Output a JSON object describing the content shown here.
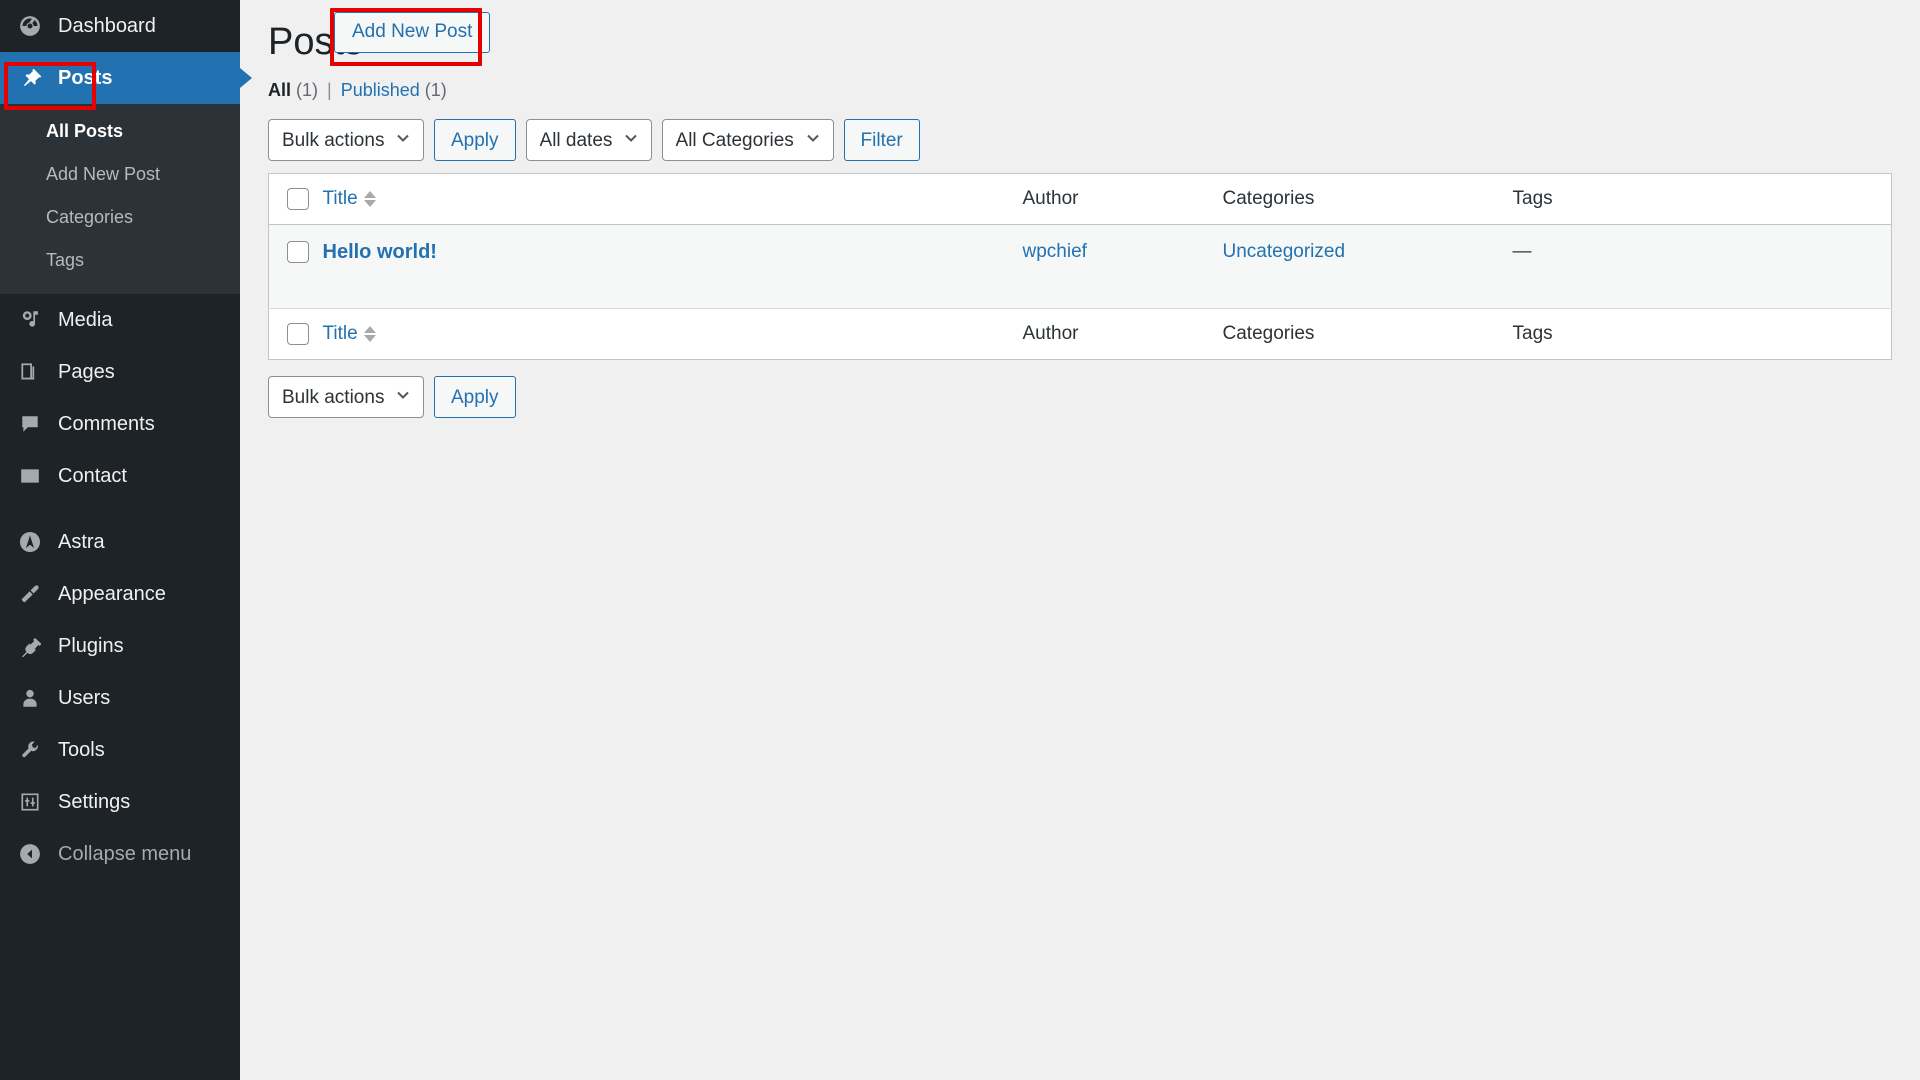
{
  "sidebar": {
    "items": [
      {
        "label": "Dashboard",
        "icon": "dashboard-icon",
        "name": "sidebar-item-dashboard",
        "current": false
      },
      {
        "label": "Posts",
        "icon": "pin-icon",
        "name": "sidebar-item-posts",
        "current": true
      },
      {
        "label": "Media",
        "icon": "media-icon",
        "name": "sidebar-item-media",
        "current": false
      },
      {
        "label": "Pages",
        "icon": "pages-icon",
        "name": "sidebar-item-pages",
        "current": false
      },
      {
        "label": "Comments",
        "icon": "comments-icon",
        "name": "sidebar-item-comments",
        "current": false
      },
      {
        "label": "Contact",
        "icon": "envelope-icon",
        "name": "sidebar-item-contact",
        "current": false
      },
      {
        "label": "Astra",
        "icon": "astra-icon",
        "name": "sidebar-item-astra",
        "current": false
      },
      {
        "label": "Appearance",
        "icon": "paintbrush-icon",
        "name": "sidebar-item-appearance",
        "current": false
      },
      {
        "label": "Plugins",
        "icon": "plug-icon",
        "name": "sidebar-item-plugins",
        "current": false
      },
      {
        "label": "Users",
        "icon": "user-icon",
        "name": "sidebar-item-users",
        "current": false
      },
      {
        "label": "Tools",
        "icon": "wrench-icon",
        "name": "sidebar-item-tools",
        "current": false
      },
      {
        "label": "Settings",
        "icon": "sliders-icon",
        "name": "sidebar-item-settings",
        "current": false
      },
      {
        "label": "Collapse menu",
        "icon": "collapse-arrow-icon",
        "name": "sidebar-collapse-menu",
        "current": false
      }
    ],
    "posts_submenu": [
      {
        "label": "All Posts",
        "current": true
      },
      {
        "label": "Add New Post",
        "current": false
      },
      {
        "label": "Categories",
        "current": false
      },
      {
        "label": "Tags",
        "current": false
      }
    ]
  },
  "header": {
    "title": "Posts",
    "add_new_label": "Add New Post"
  },
  "views": {
    "all_label": "All",
    "all_count": "(1)",
    "divider": "|",
    "published_label": "Published",
    "published_count": "(1)"
  },
  "tablenav_top": {
    "bulk_actions_value": "Bulk actions",
    "apply_label": "Apply",
    "dates_value": "All dates",
    "categories_value": "All Categories",
    "filter_label": "Filter"
  },
  "tablenav_bottom": {
    "bulk_actions_value": "Bulk actions",
    "apply_label": "Apply"
  },
  "table": {
    "columns": {
      "title": "Title",
      "author": "Author",
      "categories": "Categories",
      "tags": "Tags"
    },
    "rows": [
      {
        "title": "Hello world!",
        "author": "wpchief",
        "categories": "Uncategorized",
        "tags": "—"
      }
    ]
  },
  "colors": {
    "sidebar_bg": "#1d2327",
    "submenu_bg": "#2c3338",
    "accent_blue": "#2271b1",
    "highlight_red": "#e60000",
    "page_bg": "#f0f0f1"
  }
}
